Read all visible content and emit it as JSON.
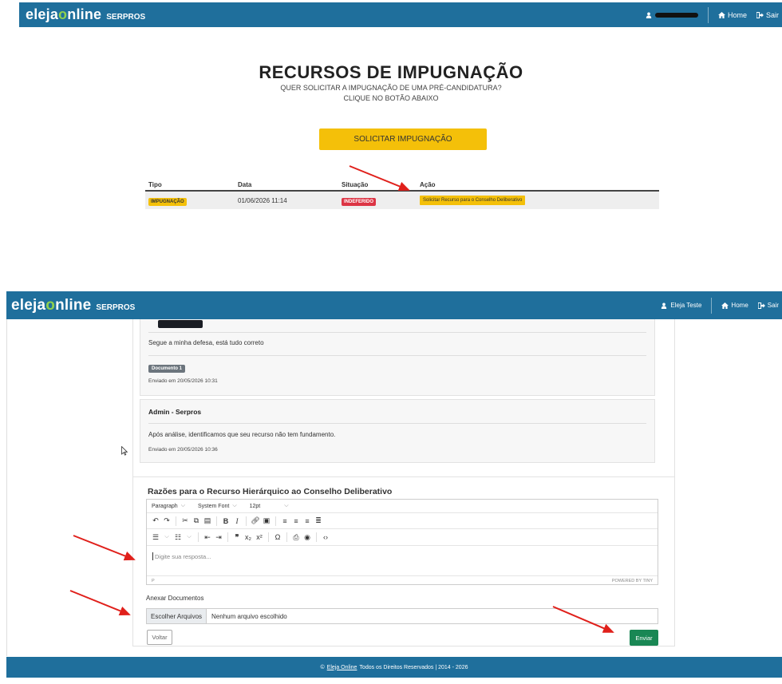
{
  "panel1": {
    "brand": {
      "name_prefix": "eleja",
      "name_o": "o",
      "name_suffix": "nline",
      "org": "SERPROS"
    },
    "nav": {
      "home": "Home",
      "logout": "Sair"
    },
    "title": "RECURSOS DE IMPUGNAÇÃO",
    "subtitle_line1": "QUER SOLICITAR A IMPUGNAÇÃO DE UMA PRÉ-CANDIDATURA?",
    "subtitle_line2": "CLIQUE NO BOTÃO ABAIXO",
    "request_button": "SOLICITAR IMPUGNAÇÃO",
    "table": {
      "headers": [
        "Tipo",
        "Data",
        "Situação",
        "Ação"
      ],
      "rows": [
        {
          "tipo": "IMPUGNAÇÃO",
          "data": "01/06/2026 11:14",
          "situacao": "INDEFERIDO",
          "acao": "Solicitar Recurso para o Conselho Deliberativo"
        }
      ]
    }
  },
  "panel2": {
    "brand": {
      "name_prefix": "eleja",
      "name_o": "o",
      "name_suffix": "nline",
      "org": "SERPROS"
    },
    "nav": {
      "user": "Eleja Teste",
      "home": "Home",
      "logout": "Sair"
    },
    "messages": [
      {
        "text": "Segue a minha defesa, está tudo correto",
        "document": "Documento 1",
        "sent": "Enviado em 20/05/2026 10:31"
      },
      {
        "author": "Admin - Serpros",
        "text": "Após análise, identificamos que seu recurso não tem fundamento.",
        "sent": "Enviado em 20/05/2026 10:36"
      }
    ],
    "section_title": "Razões para o Recurso Hierárquico ao Conselho Deliberativo",
    "editor": {
      "format": "Paragraph",
      "font": "System Font",
      "size": "12pt",
      "placeholder": "Digite sua resposta...",
      "path": "P",
      "powered": "POWERED BY TINY"
    },
    "attach_label": "Anexar Documentos",
    "file_button": "Escolher Arquivos",
    "file_status": "Nenhum arquivo escolhido",
    "back_button": "Voltar",
    "send_button": "Enviar",
    "footer": {
      "copy": "©",
      "link": "Eleja Online",
      "text": "Todos os Direitos Reservados  |  2014 - 2026"
    }
  },
  "colors": {
    "navbar": "#1f6f9c",
    "accent_yellow": "#f4c009",
    "danger": "#dc3545",
    "success": "#198754",
    "arrow": "#e0201b"
  }
}
